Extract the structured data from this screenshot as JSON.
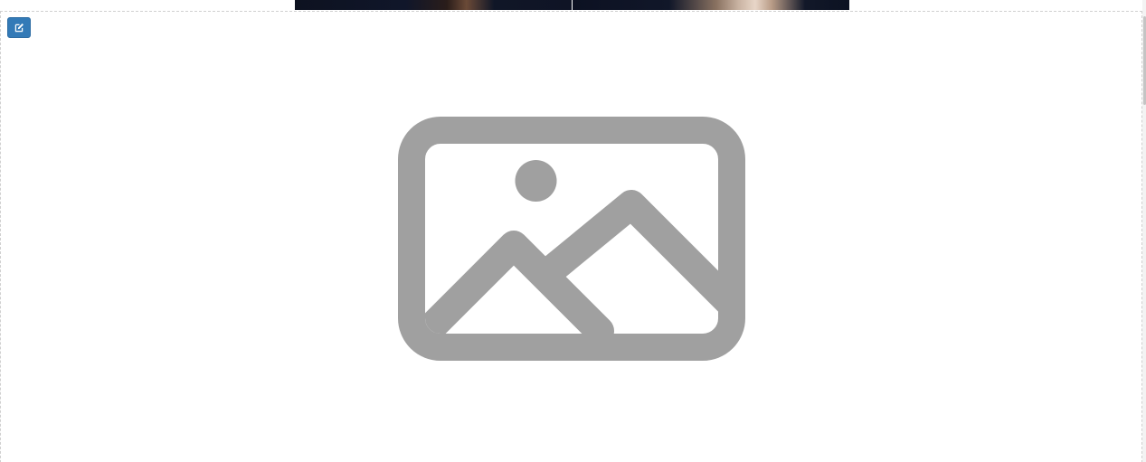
{
  "toolbar": {
    "edit_button_icon": "pencil-square-icon",
    "accent_color": "#337ab7"
  },
  "top_strip": {
    "photos": [
      "photo-left",
      "photo-right"
    ]
  },
  "image_placeholder": {
    "icon": "image-placeholder-icon",
    "icon_color": "#a0a0a0"
  }
}
